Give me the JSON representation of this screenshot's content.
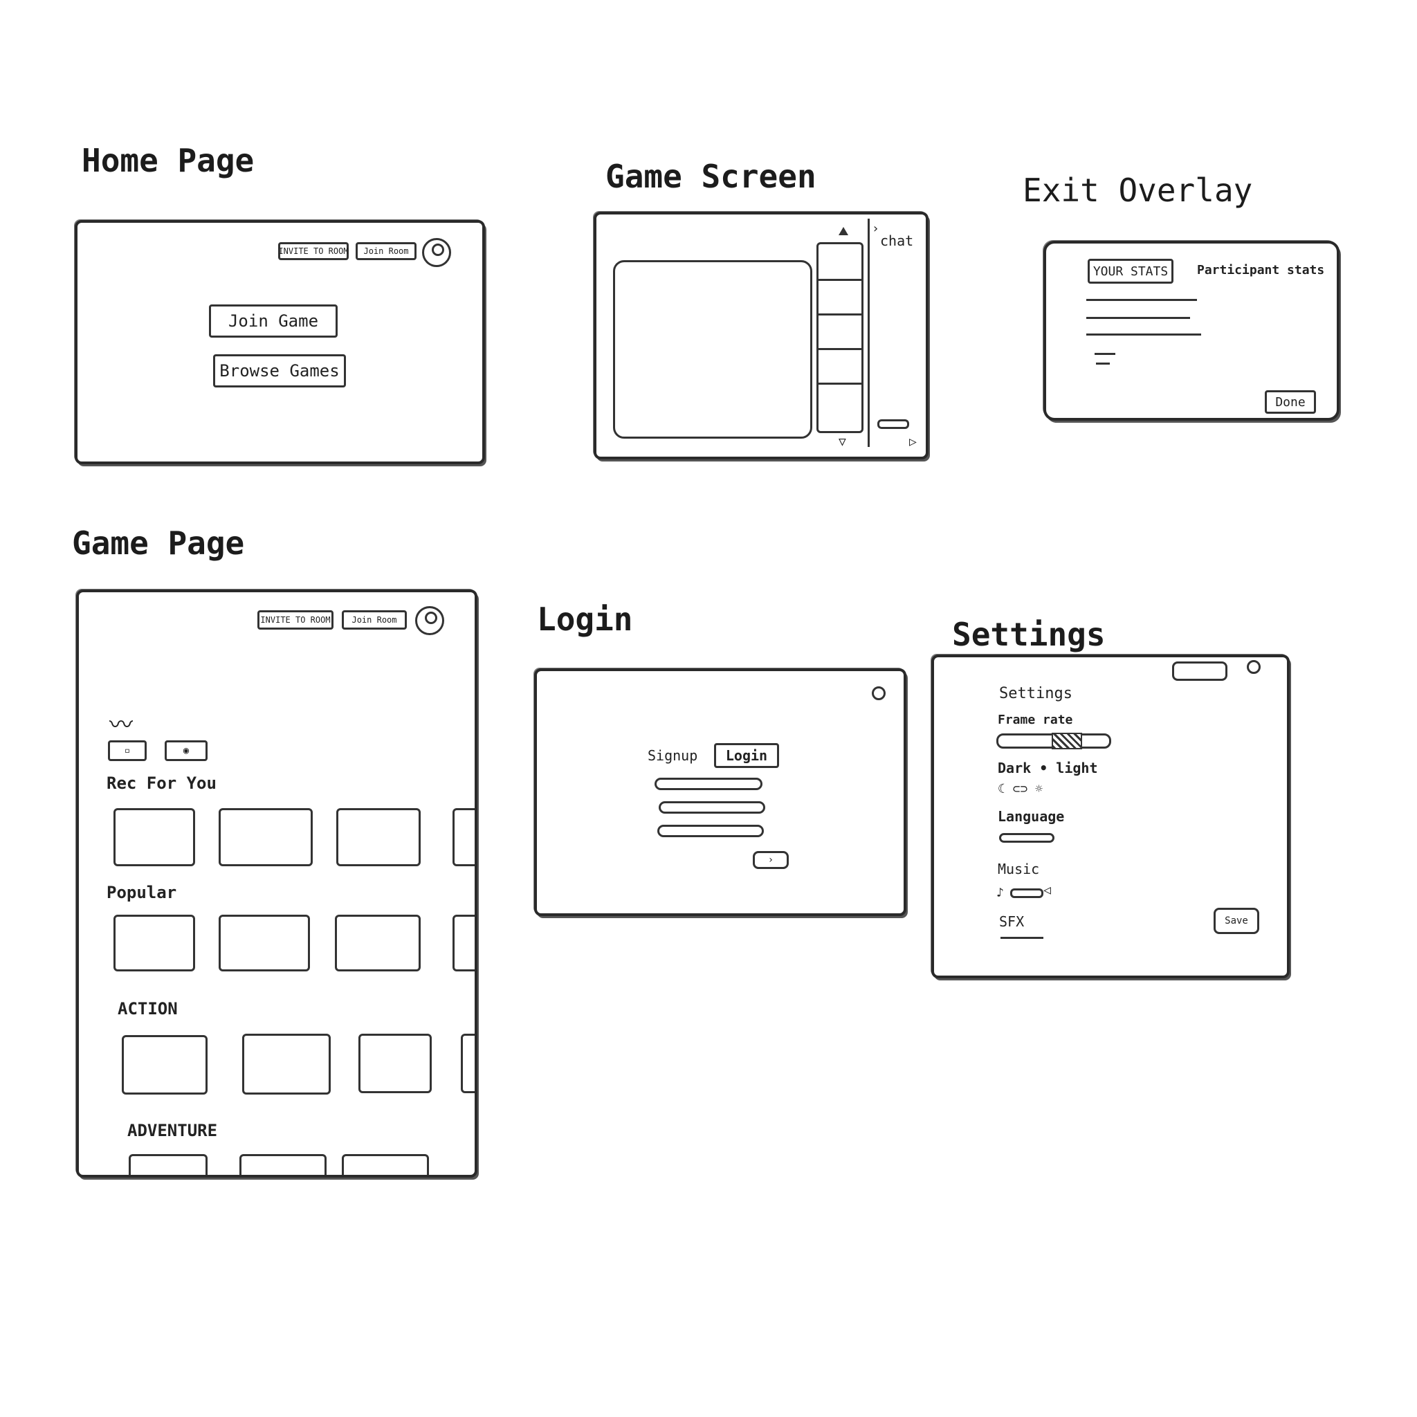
{
  "home_page": {
    "title": "Home Page",
    "invite_label": "INVITE TO ROOM",
    "join_room_label": "Join Room",
    "join_game_label": "Join Game",
    "browse_games_label": "Browse Games"
  },
  "game_screen": {
    "title": "Game Screen",
    "chat_label": "chat"
  },
  "exit_overlay": {
    "title": "Exit Overlay",
    "your_stats_tab": "YOUR STATS",
    "participant_stats_tab": "Participant stats",
    "done_label": "Done"
  },
  "game_page": {
    "title": "Game Page",
    "invite_label": "INVITE TO ROOM",
    "join_room_label": "Join Room",
    "sections": [
      "Rec For You",
      "Popular",
      "ACTION",
      "ADVENTURE"
    ]
  },
  "login": {
    "title": "Login",
    "signup_tab": "Signup",
    "login_tab": "Login"
  },
  "settings": {
    "title": "Settings",
    "heading": "Settings",
    "frame_rate_label": "Frame rate",
    "theme_label": "Dark • light",
    "language_label": "Language",
    "music_label": "Music",
    "sfx_label": "SFX",
    "save_label": "Save"
  }
}
